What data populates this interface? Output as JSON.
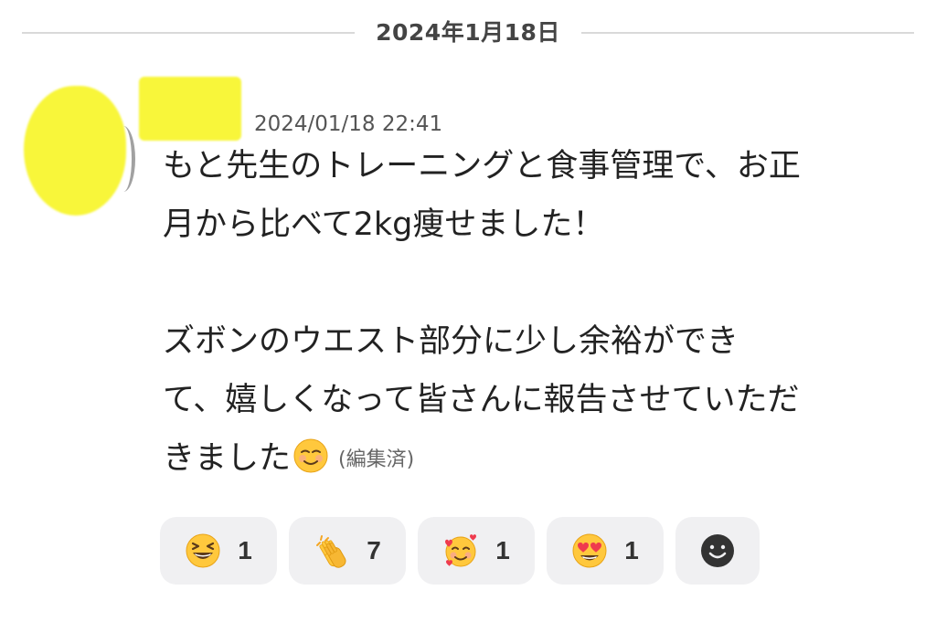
{
  "date_divider": {
    "label": "2024年1月18日"
  },
  "message": {
    "author": {
      "avatar_redacted": true,
      "name_redacted": true
    },
    "timestamp": "2024/01/18 22:41",
    "lines": [
      "もと先生のトレーニングと食事管理で、お正",
      "月から比べて2kg痩せました！",
      "",
      "ズボンのウエスト部分に少し余裕ができ",
      "て、嬉しくなって皆さんに報告させていただ",
      "きました"
    ],
    "trailing_emoji": "smiling-face-icon",
    "edited_label": "(編集済)"
  },
  "reactions": [
    {
      "icon": "grinning-squinting-face-icon",
      "count": "1"
    },
    {
      "icon": "clapping-hands-icon",
      "count": "7"
    },
    {
      "icon": "smiling-face-with-hearts-icon",
      "count": "1"
    },
    {
      "icon": "heart-eyes-face-icon",
      "count": "1"
    }
  ],
  "add_reaction": {
    "icon": "add-reaction-smiley-icon"
  },
  "colors": {
    "redaction": "#f8f63a",
    "reaction_bg": "#f0f0f2",
    "divider": "#d9d9d9",
    "emoji_face": "#ffc83d",
    "emoji_outline": "#e8a317",
    "heart": "#ef3b4e",
    "add_icon": "#333333"
  }
}
